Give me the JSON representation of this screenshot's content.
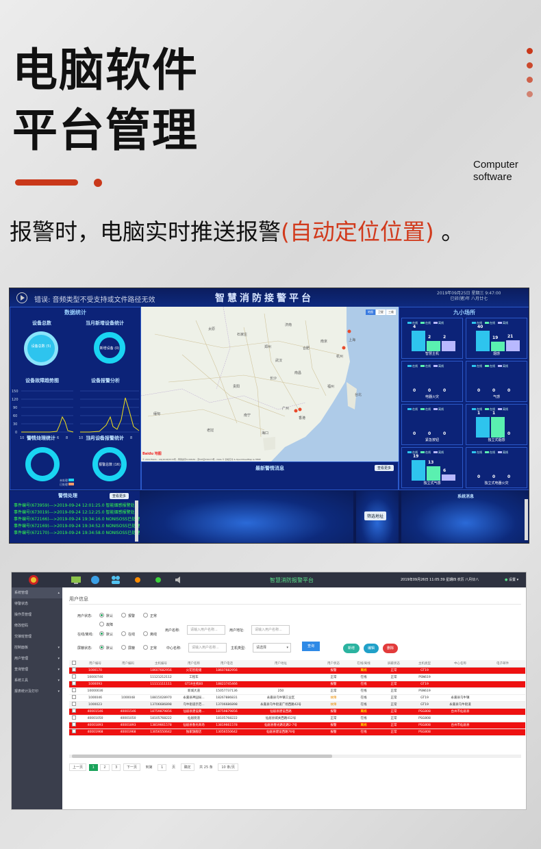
{
  "header": {
    "title_line1": "电脑软件",
    "title_line2": "平台管理",
    "english_caption_line1": "Computer",
    "english_caption_line2": "software",
    "subtitle_prefix": "报警时，电脑实时推送报警",
    "subtitle_highlight": "(自动定位位置)",
    "subtitle_suffix": " 。"
  },
  "colors": {
    "accent": "#c9381a",
    "highlight": "#d13a1c",
    "dashboard_bg": "#0a1850",
    "alarm_row": "#ee1111"
  },
  "dashboard": {
    "warning_text": "错误: 音频类型不受支持或文件路径无效",
    "title": "智慧消防接警平台",
    "datetime_line1": "2019年09月25日 星期三 9:47:00",
    "datetime_line2": "已卯(猪)年 八月廿七",
    "left_header": "数据统计",
    "sections": {
      "device_total": "设备总数",
      "device_total_bubble": "设备总数 (5)",
      "new_devices": "当月新增设备统计",
      "new_devices_ring": "新增设备 (0)",
      "fault_trend": "设备故障趋势图",
      "alarm_analysis": "设备报警分析",
      "alarm_handling": "警情处理统计",
      "monthly_alarms": "当月设备报警统计",
      "monthly_alarms_ring": "报警总数 (16)"
    },
    "fault_y_ticks": [
      "150",
      "120",
      "90",
      "60",
      "30",
      "0"
    ],
    "fault_x_ticks": [
      "10",
      "12",
      "2",
      "4",
      "6",
      "8"
    ],
    "alarm_x_ticks": [
      "10",
      "12",
      "2",
      "4",
      "6",
      "8"
    ],
    "handling_legend": [
      "未处理",
      "已处理"
    ],
    "map": {
      "layer_buttons": [
        "地图",
        "卫星",
        "三维"
      ],
      "logo": "Baidu 地图",
      "attribution": "© 2019 Baidu - GS(2018)5572号 - 甲测资字1100930 - 京ICP证030173号 - Data © 长地万方 & OpenStreetMap & HERE",
      "cities": [
        "太原",
        "石家庄",
        "济南",
        "郑州",
        "南京",
        "上海",
        "合肥",
        "武汉",
        "杭州",
        "长沙",
        "南昌",
        "福州",
        "台北",
        "贵阳",
        "广州",
        "香港",
        "南宁",
        "海口",
        "缅甸",
        "老挝"
      ]
    },
    "latest_alarm_title": "最新警情消息",
    "view_more": "查看更多",
    "alarm_log_title": "警情处理",
    "alarm_log": [
      "事件编号(673959)--->2019-09-24 12:01:25.0 智能烟感报警处理",
      "事件编号(673019)--->2019-09-24 12:12:25.0 智能烟感报警处理",
      "事件编号(672166)--->2019-09-24 19:34:16.0 NONISOSS已处理",
      "事件编号(672169)--->2019-09-24 19:34:52.0 NONISOSS已处理",
      "事件编号(672170)--->2019-09-24 19:34:58.0 NONISOSS已处理"
    ],
    "filter_button": "筛选地址",
    "nine_places_title": "九小场所",
    "system_messages_title": "系统消息",
    "mini_legend": [
      "在线",
      "在线",
      "离线"
    ],
    "mini_panels": [
      {
        "label": "智慧主机",
        "values": [
          "4",
          "2",
          "2"
        ]
      },
      {
        "label": "烟感",
        "values": [
          "40",
          "19",
          "21"
        ]
      },
      {
        "label": "电器火灾",
        "values": [
          "0",
          "0",
          "0"
        ]
      },
      {
        "label": "气感",
        "values": [
          "0",
          "0",
          "0"
        ]
      },
      {
        "label": "紧急按钮",
        "values": [
          "0",
          "0",
          "0"
        ]
      },
      {
        "label": "独立式烟感",
        "values": [
          "1",
          "1",
          "0"
        ]
      },
      {
        "label": "独立式气感",
        "values": [
          "19",
          "13",
          "6"
        ]
      },
      {
        "label": "独立式电器火灾",
        "values": [
          "0",
          "0",
          "0"
        ]
      }
    ]
  },
  "admin": {
    "title": "智慧消防报警平台",
    "datetime": "2019年09月26日 11:05:39 星期四 农历 八月廿八",
    "settings": "设置",
    "sidebar": [
      {
        "label": "系统管理",
        "header": true
      },
      {
        "label": "待警状态",
        "header": false
      },
      {
        "label": "操作员管理",
        "header": false
      },
      {
        "label": "修改密码",
        "header": false
      },
      {
        "label": "交接班管理",
        "header": false
      },
      {
        "label": "控制面板",
        "header": false
      },
      {
        "label": "用户管理",
        "header": false
      },
      {
        "label": "查询管理",
        "header": false
      },
      {
        "label": "系统工具",
        "header": false
      },
      {
        "label": "报表统计及打印",
        "header": false
      }
    ],
    "section_title": "用户信息",
    "filters": {
      "user_status_label": "用户状态:",
      "user_status_options": [
        "默认",
        "报警",
        "正常",
        "故障"
      ],
      "online_label": "在线/离线:",
      "online_options": [
        "默认",
        "在线",
        "离线"
      ],
      "shield_label": "屏蔽状态:",
      "shield_options": [
        "默认",
        "屏蔽",
        "正常"
      ],
      "user_name_label": "用户名称:",
      "user_name_placeholder": "请输入用户名称...",
      "user_address_label": "用户地址:",
      "user_address_placeholder": "请输入用户名称...",
      "center_name_label": "中心名称:",
      "center_name_placeholder": "请输入用户名称...",
      "host_type_label": "主机类型:",
      "host_type_value": "请选择",
      "search_button": "查询",
      "add_button": "新增",
      "edit_button": "编辑",
      "delete_button": "删除"
    },
    "table": {
      "columns": [
        "用户编号",
        "用户编码",
        "主机编号",
        "用户名称",
        "用户电话",
        "用户地址",
        "用户状态",
        "在线/离线",
        "屏蔽状态",
        "主机类型",
        "中心名称",
        "电子邮件"
      ],
      "rows": [
        {
          "style": "red",
          "cells": [
            "1000170",
            "",
            "18607682956",
            "火花智能储",
            "18607682956",
            "",
            "报警",
            "离线",
            "正常",
            "GT19",
            "",
            ""
          ]
        },
        {
          "style": "plain",
          "cells": [
            "10000746",
            "",
            "11121212112",
            "工程车",
            "",
            "",
            "正常",
            "在线",
            "正常",
            "PSN619",
            "",
            ""
          ]
        },
        {
          "style": "red",
          "cells": [
            "1000093",
            "",
            "11111111111",
            "GT19主机60",
            "18823745466",
            "",
            "报警",
            "在线",
            "正常",
            "GT19",
            "",
            ""
          ]
        },
        {
          "style": "plain",
          "cells": [
            "10000036",
            "",
            "",
            "新城大道",
            "15057737136",
            "250",
            "正常",
            "在线",
            "正常",
            "PSN619",
            "",
            ""
          ]
        },
        {
          "style": "plain",
          "cells": [
            "1000046",
            "1000048",
            "18815028970",
            "永嘉县神园局...",
            "18267886831",
            "永嘉县乌牛镇工业区",
            "故障",
            "在线",
            "正常",
            "GT19",
            "永嘉县乌牛镇",
            ""
          ]
        },
        {
          "style": "grey",
          "cells": [
            "1000023",
            "",
            "13706686898",
            "乌牛街道示范...",
            "13706686898",
            "永嘉县乌牛街道广场西路42号",
            "故障",
            "在线",
            "正常",
            "GT19",
            "永嘉县乌牛街道",
            ""
          ]
        },
        {
          "style": "red",
          "cells": [
            "40001546",
            "40001546",
            "18759879856",
            "仙居县建设路...",
            "18759879856",
            "仙居县建设西路",
            "报警",
            "离线",
            "正常",
            "PSG808",
            "台州市仙居县",
            ""
          ]
        },
        {
          "style": "plain",
          "cells": [
            "40001050",
            "40001050",
            "18105768222",
            "仙居街道",
            "18105768222",
            "仙居县城关西路412号",
            "正常",
            "在线",
            "正常",
            "PSG808",
            "",
            ""
          ]
        },
        {
          "style": "red",
          "cells": [
            "40001893",
            "40001893",
            "13819661578",
            "仙居县春光商场",
            "13819661578",
            "仙居县春光路北路2-7号",
            "报警",
            "离线",
            "正常",
            "PSG808",
            "台州市仙居县",
            ""
          ]
        },
        {
          "style": "red",
          "cells": [
            "40001968",
            "40001968",
            "13056550642",
            "独家旗舰店",
            "13056550642",
            "仙居县建设西路76号",
            "报警",
            "在线",
            "正常",
            "PSG808",
            "",
            ""
          ]
        }
      ]
    },
    "pager": {
      "prev": "上一页",
      "pages": [
        "1",
        "2",
        "3"
      ],
      "current": "1",
      "next": "下一页",
      "goto_label": "到第",
      "goto_value": "1",
      "page_unit": "页",
      "confirm": "确定",
      "total": "共 25 条",
      "per_page": "10 条/页"
    }
  }
}
